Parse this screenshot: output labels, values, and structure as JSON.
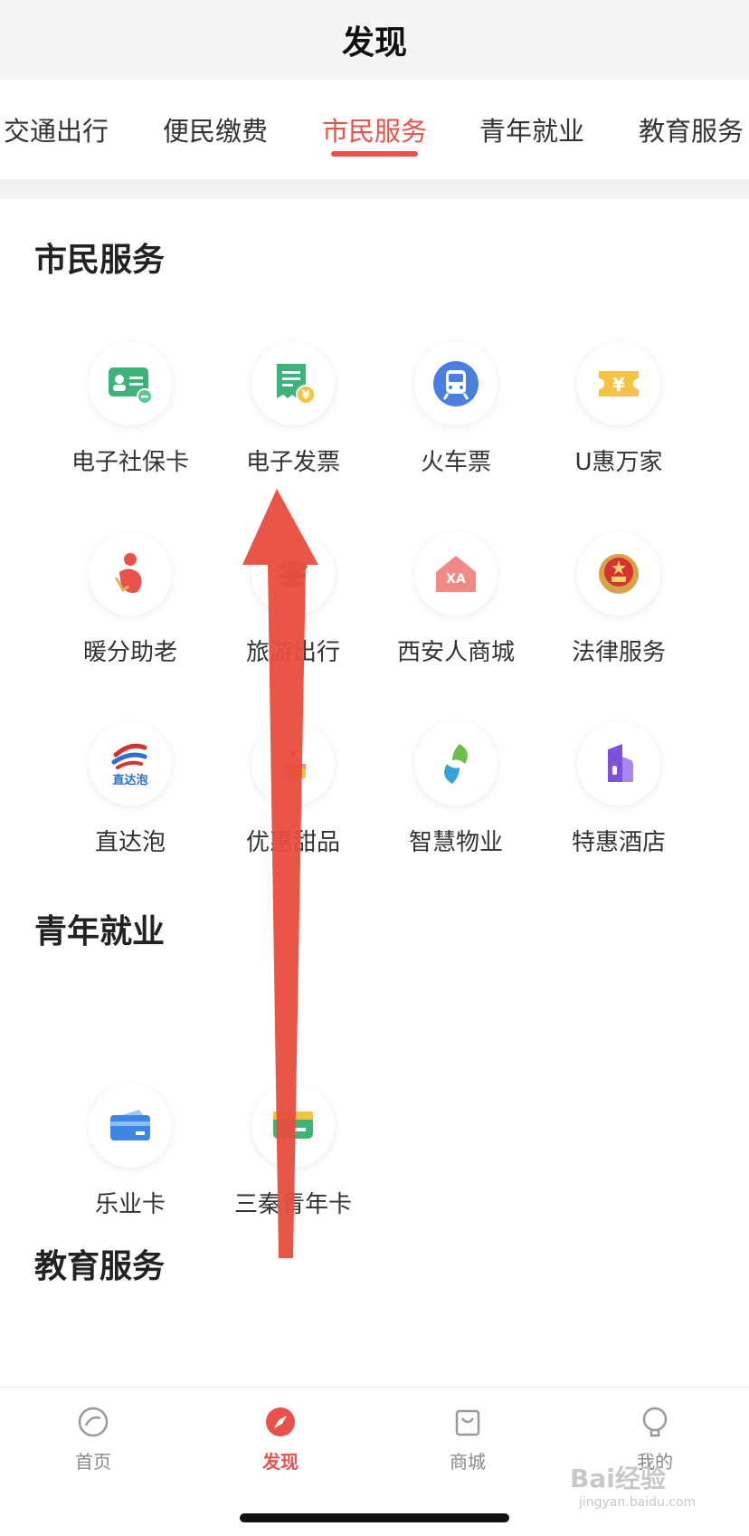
{
  "header": {
    "title": "发现"
  },
  "tabs": [
    {
      "label": "交通出行"
    },
    {
      "label": "便民缴费"
    },
    {
      "label": "市民服务",
      "active": true
    },
    {
      "label": "青年就业"
    },
    {
      "label": "教育服务"
    }
  ],
  "sections": {
    "citizen": {
      "title": "市民服务",
      "items": [
        {
          "label": "电子社保卡",
          "icon": "social-security-card-icon"
        },
        {
          "label": "电子发票",
          "icon": "e-invoice-icon"
        },
        {
          "label": "火车票",
          "icon": "train-icon"
        },
        {
          "label": "U惠万家",
          "icon": "yuan-coupon-icon"
        },
        {
          "label": "暖分助老",
          "icon": "elderly-care-icon"
        },
        {
          "label": "旅游出行",
          "icon": "travel-icon"
        },
        {
          "label": "西安人商城",
          "icon": "xa-mall-icon"
        },
        {
          "label": "法律服务",
          "icon": "national-emblem-icon"
        },
        {
          "label": "直达泡",
          "icon": "zhidapao-logo-icon",
          "logo_text": "直达泡"
        },
        {
          "label": "优惠甜品",
          "icon": "dessert-icon"
        },
        {
          "label": "智慧物业",
          "icon": "smart-property-icon"
        },
        {
          "label": "特惠酒店",
          "icon": "hotel-icon"
        }
      ]
    },
    "youth": {
      "title": "青年就业",
      "items": [
        {
          "label": "乐业卡",
          "icon": "blue-card-icon"
        },
        {
          "label": "三秦青年卡",
          "icon": "green-card-icon"
        }
      ]
    },
    "education": {
      "title": "教育服务"
    }
  },
  "bottom_nav": [
    {
      "label": "首页",
      "icon": "home-icon"
    },
    {
      "label": "发现",
      "icon": "compass-icon",
      "active": true
    },
    {
      "label": "商城",
      "icon": "shopping-bag-icon"
    },
    {
      "label": "我的",
      "icon": "profile-icon"
    }
  ],
  "watermark": {
    "text": "Bai经验",
    "sub": "jingyan.baidu.com"
  },
  "colors": {
    "accent": "#e8524a",
    "arrow": "#e84c3d",
    "header_bg": "#f5f5f5"
  }
}
